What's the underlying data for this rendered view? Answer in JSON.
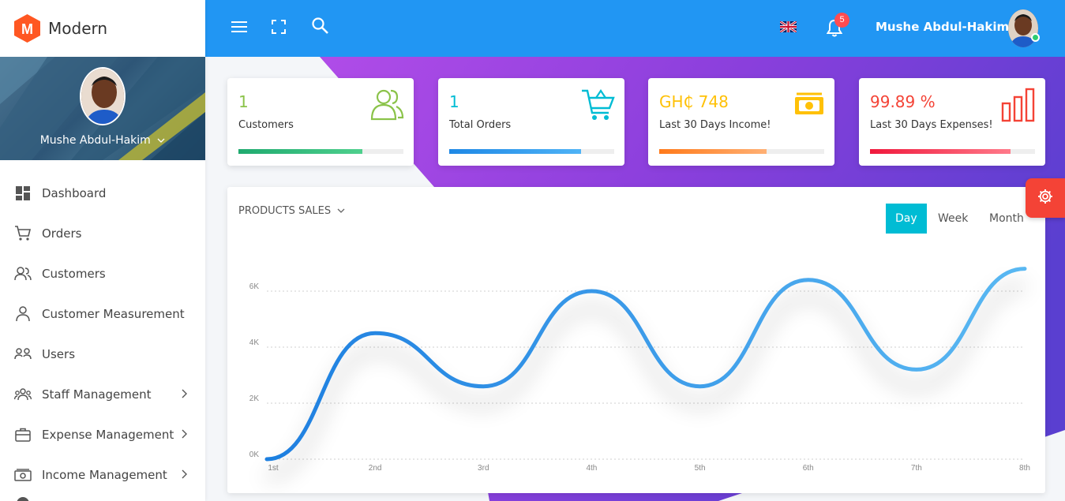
{
  "brand": {
    "name": "Modern",
    "logo_letter": "M"
  },
  "profile": {
    "name": "Mushe Abdul-Hakim"
  },
  "sidebar": {
    "items": [
      {
        "label": "Dashboard",
        "icon": "dashboard-icon",
        "has_arrow": false
      },
      {
        "label": "Orders",
        "icon": "cart-icon",
        "has_arrow": false
      },
      {
        "label": "Customers",
        "icon": "users-icon",
        "has_arrow": false
      },
      {
        "label": "Customer Measurement",
        "icon": "user-icon",
        "has_arrow": false
      },
      {
        "label": "Users",
        "icon": "user-group-icon",
        "has_arrow": false
      },
      {
        "label": "Staff Management",
        "icon": "staff-icon",
        "has_arrow": true
      },
      {
        "label": "Expense Management",
        "icon": "briefcase-icon",
        "has_arrow": true
      },
      {
        "label": "Income Management",
        "icon": "cash-icon",
        "has_arrow": true
      }
    ]
  },
  "topbar": {
    "user_name": "Mushe Abdul-Hakim",
    "notification_count": "5",
    "language": "en-GB"
  },
  "cards": [
    {
      "value": "1",
      "label": "Customers",
      "color": "#8bc34a",
      "bar_from": "#1faa6f",
      "bar_to": "#4fd08d",
      "progress": 0.75
    },
    {
      "value": "1",
      "label": "Total Orders",
      "color": "#00bcd4",
      "bar_from": "#1e88e5",
      "bar_to": "#4fb3f6",
      "progress": 0.8
    },
    {
      "value": "GH₵ 748",
      "label": "Last 30 Days Income!",
      "color": "#ffc107",
      "bar_from": "#ff7a1a",
      "bar_to": "#ffb074",
      "progress": 0.65
    },
    {
      "value": "99.89 %",
      "label": "Last 30 Days Expenses!",
      "color": "#f44336",
      "bar_from": "#f0183c",
      "bar_to": "#ff7a8a",
      "progress": 0.85
    }
  ],
  "panel": {
    "title": "PRODUCTS SALES",
    "periods": [
      "Day",
      "Week",
      "Month"
    ],
    "active_period": "Day"
  },
  "chart_data": {
    "type": "line",
    "categories": [
      "1st",
      "2nd",
      "3rd",
      "4th",
      "5th",
      "6th",
      "7th",
      "8th"
    ],
    "y_ticks": [
      "0K",
      "2K",
      "4K",
      "6K"
    ],
    "ylim": [
      0,
      6000
    ],
    "series": [
      {
        "values": [
          0,
          4500,
          2600,
          6000,
          2600,
          6400,
          3200,
          6800
        ]
      }
    ],
    "grid": true,
    "color_from": "#1e7fe0",
    "color_to": "#5ab8f2"
  }
}
